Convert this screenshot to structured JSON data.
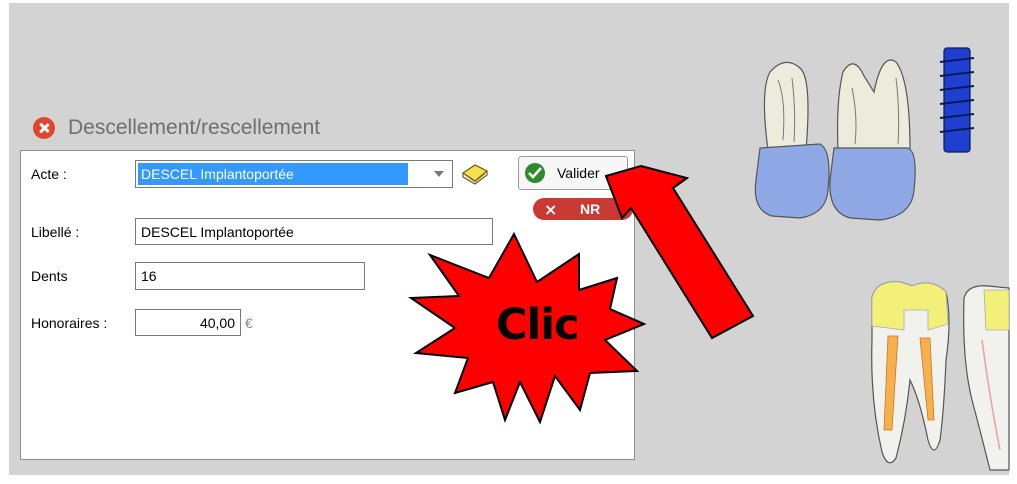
{
  "dialog": {
    "title": "Descellement/rescellement",
    "fields": {
      "acte_label": "Acte :",
      "acte_value": "DESCEL Implantoportée",
      "libelle_label": "Libellé :",
      "libelle_value": "DESCEL Implantoportée",
      "dents_label": "Dents",
      "dents_value": "16",
      "honoraires_label": "Honoraires :",
      "honoraires_value": "40,00",
      "currency": "€"
    },
    "buttons": {
      "validate_label": "Valider",
      "nr_label": "NR",
      "nr_icon": "×"
    }
  },
  "annotation": {
    "text": "Clic",
    "arrow_color": "#ff0000",
    "starburst_color": "#ff0000"
  },
  "icons": {
    "close": "close-icon",
    "book": "book-icon",
    "validate": "check-circle-icon",
    "nr": "x-icon"
  },
  "colors": {
    "background": "#d3d3d3",
    "selection": "#3399ff",
    "close_red": "#e0462b",
    "validate_green": "#2e8b2e",
    "nr_red": "#c93a34",
    "crown_blue": "#8fa8e6",
    "implant_blue": "#1f3fd0",
    "filling_yellow": "#f3f07a",
    "canal_orange": "#f6b04d"
  }
}
